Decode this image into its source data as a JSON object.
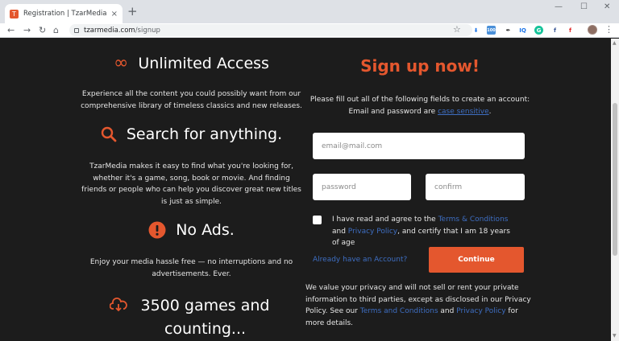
{
  "browser": {
    "tab_title": "Registration | TzarMedia",
    "favicon_letter": "T",
    "tab_close": "×",
    "new_tab": "+",
    "win_minimize": "—",
    "win_maximize": "☐",
    "win_close": "✕",
    "url_host": "tzarmedia.com",
    "url_path": "/signup",
    "extensions": [
      "download-icon",
      "ext-100-icon",
      "pen-icon",
      "iq-icon",
      "grammarly-icon",
      "facebook-icon",
      "flipboard-icon"
    ],
    "ext_labels": [
      "⬇",
      "100",
      "✒",
      "IQ",
      "G",
      "f",
      "f"
    ]
  },
  "features": [
    {
      "icon": "infinity-icon",
      "glyph": "∞",
      "title": "Unlimited Access",
      "text": "Experience all the content you could possibly want from our comprehensive library of timeless classics and new releases."
    },
    {
      "icon": "search-icon",
      "glyph": "",
      "title": "Search for anything.",
      "text": "TzarMedia makes it easy to find what you're looking for, whether it's a game, song, book or movie. And finding friends or people who can help you discover great new titles is just as simple."
    },
    {
      "icon": "no-ads-icon",
      "glyph": "!",
      "title": "No Ads.",
      "text": "Enjoy your media hassle free — no interruptions and no advertisements. Ever."
    },
    {
      "icon": "cloud-download-icon",
      "glyph": "",
      "title": "3500 games and counting...",
      "text": ""
    }
  ],
  "signup": {
    "title": "Sign up now!",
    "intro": "Please fill out all of the following fields to create an account:",
    "intro2_prefix": "Email and password are ",
    "intro2_link": "case sensitive",
    "intro2_suffix": ".",
    "email_placeholder": "email@mail.com",
    "password_placeholder": "password",
    "confirm_placeholder": "confirm",
    "agree_prefix": "I have read and agree to the ",
    "terms_link": "Terms & Conditions",
    "agree_and": " and ",
    "privacy_link": "Privacy Policy",
    "agree_suffix": ", and certify that I am 18 years of age",
    "already_link": "Already have an Account?",
    "continue_label": "Continue",
    "privacy_prefix": "We value your privacy and will not sell or rent your private information to third parties, except as disclosed in our Privacy Policy. See our ",
    "privacy_terms_link": "Terms and Conditions",
    "privacy_and": " and ",
    "privacy_policy_link": "Privacy Policy",
    "privacy_suffix": " for more details."
  },
  "colors": {
    "accent": "#e4572e",
    "background": "#1c1c1c",
    "link": "#3e6ec2"
  }
}
